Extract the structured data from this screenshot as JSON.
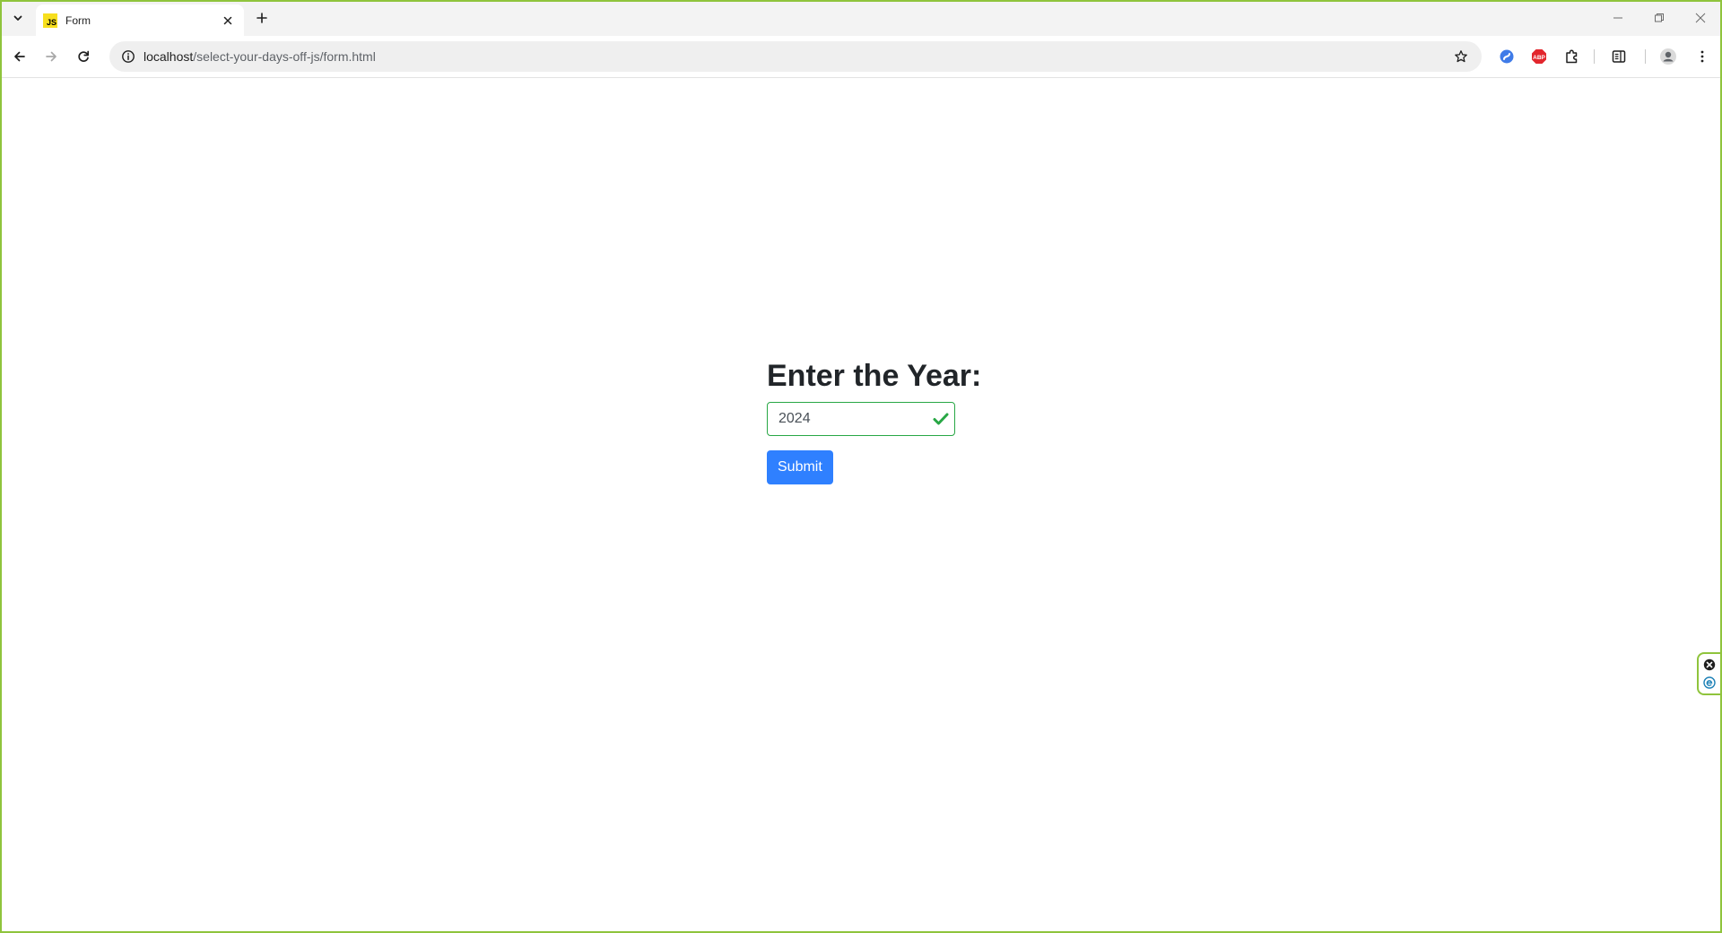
{
  "browser": {
    "tab": {
      "title": "Form",
      "favicon_text": "JS",
      "favicon_color": "#f7df1e"
    },
    "address": {
      "host": "localhost",
      "path": "/select-your-days-off-js/form.html"
    }
  },
  "page": {
    "heading": "Enter the Year:",
    "year_input": {
      "value": "2024"
    },
    "submit_label": "Submit",
    "colors": {
      "button": "#2f80ff",
      "valid": "#28a745"
    }
  }
}
